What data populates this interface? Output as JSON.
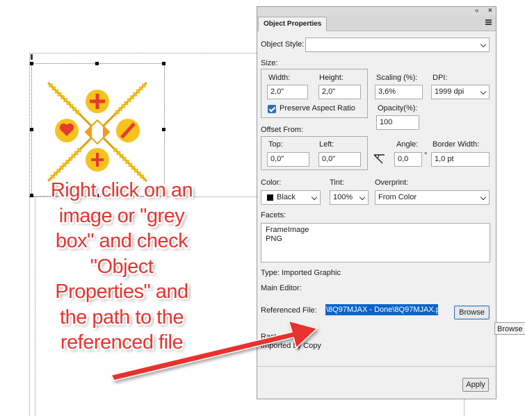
{
  "annotation": {
    "lines": [
      "Right click on an",
      "image or \"grey",
      "box\" and check",
      "\"Object",
      "Properties\" and",
      "the path to the",
      "referenced file"
    ]
  },
  "panel": {
    "top_controls": {
      "collapse": "«",
      "close": "×"
    },
    "tab_label": "Object Properties",
    "object_style": {
      "label": "Object Style:",
      "value": ""
    },
    "size": {
      "section_label": "Size:",
      "width_label": "Width:",
      "width_value": "2,0\"",
      "height_label": "Height:",
      "height_value": "2,0\"",
      "preserve_label": "Preserve Aspect Ratio",
      "preserve_checked": true,
      "scaling_label": "Scaling (%):",
      "scaling_value": "3,6%",
      "dpi_label": "DPI:",
      "dpi_value": "1999 dpi",
      "opacity_label": "Opacity(%):",
      "opacity_value": "100"
    },
    "offset": {
      "section_label": "Offset From:",
      "top_label": "Top:",
      "top_value": "0,0\"",
      "left_label": "Left:",
      "left_value": "0,0\"",
      "angle_label": "Angle:",
      "angle_value": "0,0",
      "degree_symbol": "°",
      "border_label": "Border Width:",
      "border_value": "1,0 pt"
    },
    "color": {
      "label": "Color:",
      "value": "Black",
      "swatch": "#000000"
    },
    "tint": {
      "label": "Tint:",
      "value": "100%"
    },
    "overprint": {
      "label": "Overprint:",
      "value": "From Color"
    },
    "facets": {
      "label": "Facets:",
      "items": [
        "FrameImage",
        "PNG"
      ]
    },
    "type_text": "Type: Imported Graphic",
    "main_editor_label": "Main Editor:",
    "referenced_file": {
      "label": "Referenced File:",
      "value": "\\8Q97MJAX - Done\\8Q97MJAX.p",
      "browse_label": "Browse"
    },
    "tooltip_text": "Browse",
    "raster_label": "Raster File:",
    "import_mode": "Imported by Copy",
    "apply_label": "Apply"
  },
  "colors": {
    "annotation_red": "#e8332f",
    "selection_blue": "#0a64c8",
    "checkbox_blue": "#2a6fb8"
  }
}
